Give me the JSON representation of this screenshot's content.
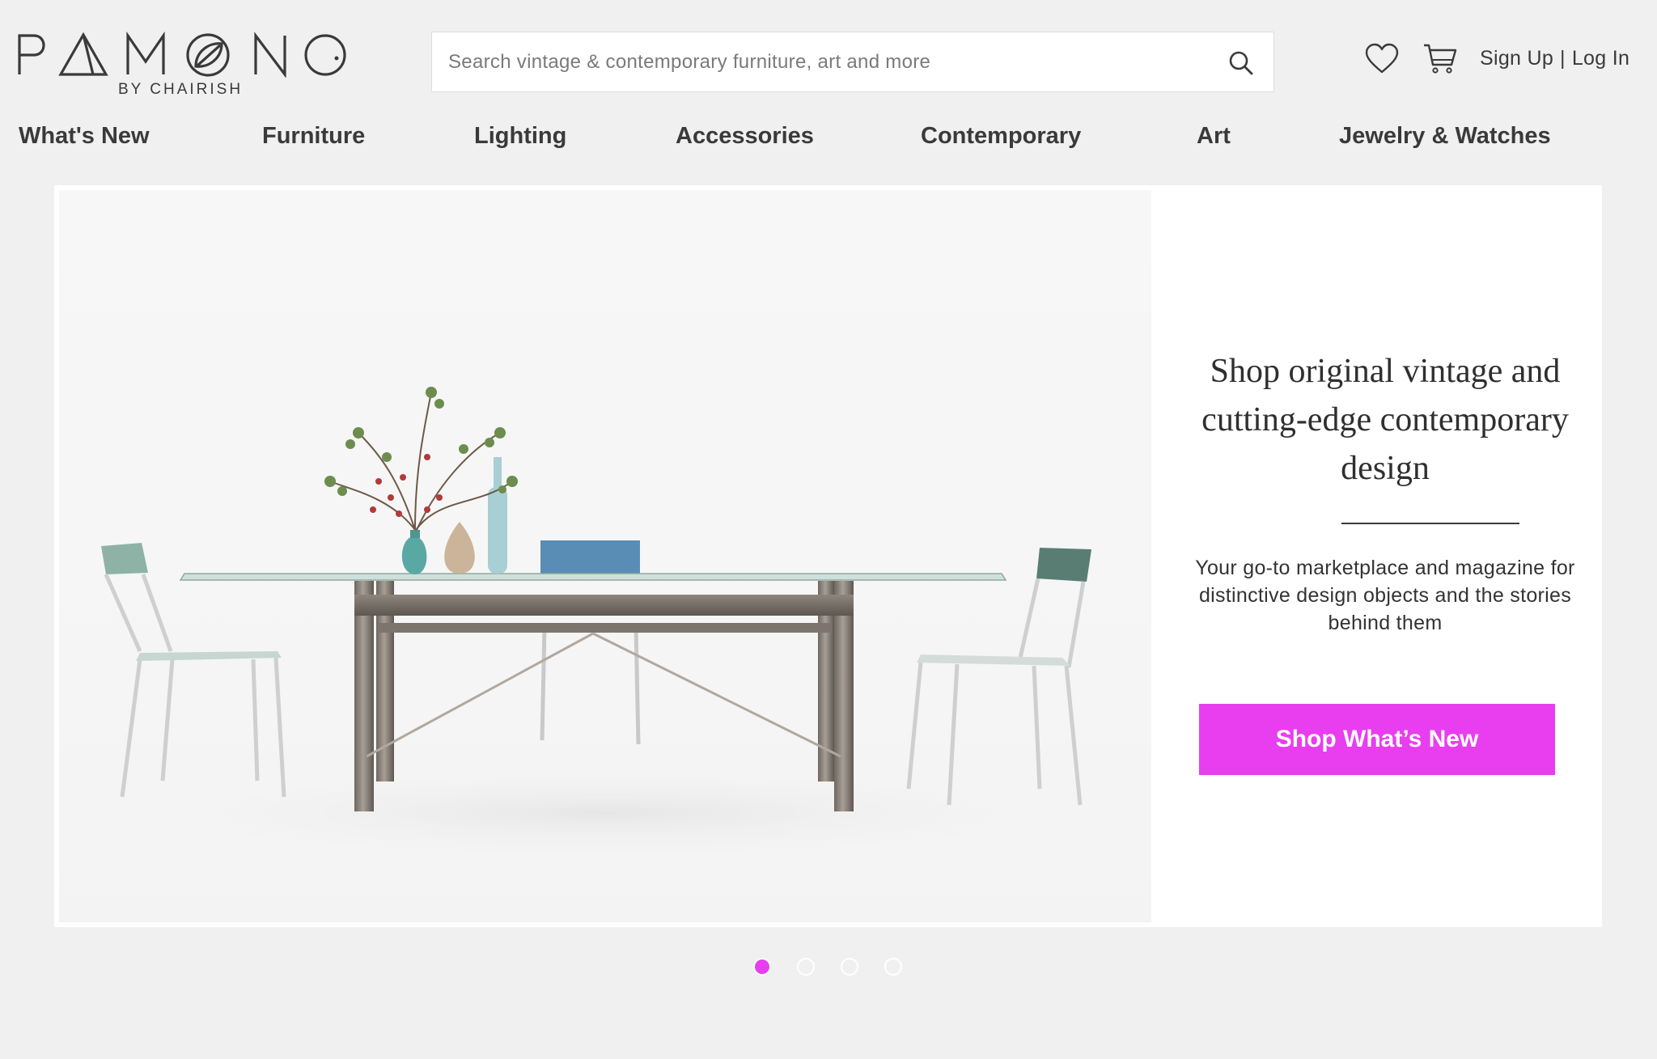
{
  "brand": {
    "logo_text": "PAMONO",
    "tagline": "BY CHAIRISH"
  },
  "search": {
    "placeholder": "Search vintage & contemporary furniture, art and more",
    "icon": "search-icon"
  },
  "header": {
    "favorites_icon": "heart-icon",
    "cart_icon": "cart-icon",
    "sign_up": "Sign Up",
    "separator": "|",
    "log_in": "Log In"
  },
  "nav": {
    "items": [
      {
        "label": "What's New"
      },
      {
        "label": "Furniture"
      },
      {
        "label": "Lighting"
      },
      {
        "label": "Accessories"
      },
      {
        "label": "Contemporary"
      },
      {
        "label": "Art"
      },
      {
        "label": "Jewelry & Watches"
      }
    ]
  },
  "hero": {
    "title": "Shop original vintage and cutting-edge contemporary design",
    "subtitle": "Your go-to marketplace and magazine for distinctive design objects and the stories behind them",
    "cta_label": "Shop What’s New"
  },
  "carousel": {
    "slide_count": 4,
    "active_index": 0
  },
  "colors": {
    "background": "#f1f0f0",
    "accent": "#e83ef0",
    "text": "#333333"
  }
}
